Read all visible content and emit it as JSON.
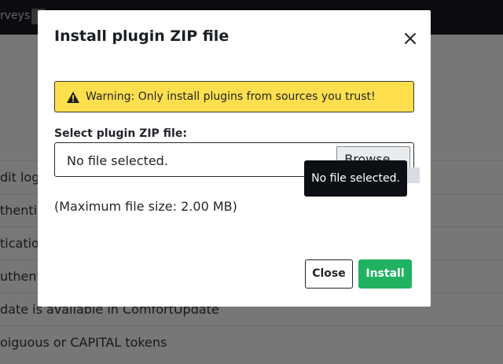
{
  "background": {
    "topbar_text": "rveys",
    "rows": [
      "dit log",
      "thentic",
      "tication",
      "uthenti",
      "date is available in ComfortUpdate",
      "oiguous or CAPITAL tokens"
    ]
  },
  "modal": {
    "title": "Install plugin ZIP file",
    "close_icon": "close-icon",
    "warning": {
      "icon": "warning-triangle-icon",
      "text": "Warning: Only install plugins from sources you trust!",
      "color": "#ffdf4d"
    },
    "file_field": {
      "label": "Select plugin ZIP file:",
      "status": "No file selected.",
      "browse_label": "Browse..."
    },
    "max_size_text": "(Maximum file size: 2.00 MB)",
    "buttons": {
      "close_label": "Close",
      "install_label": "Install",
      "install_color": "#20b261"
    }
  },
  "tooltip": {
    "text": "No file selected."
  }
}
